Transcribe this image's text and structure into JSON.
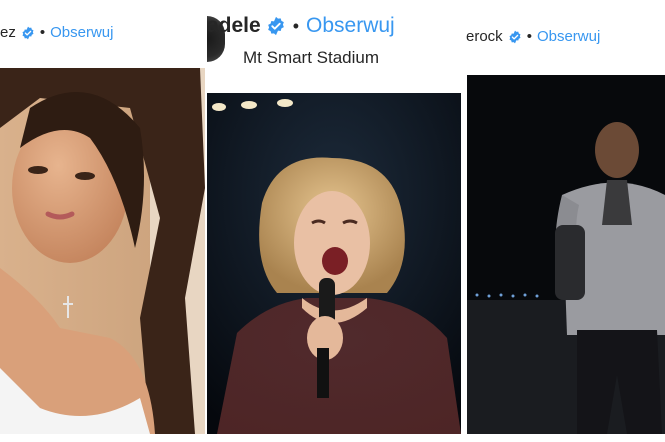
{
  "posts": [
    {
      "username": "ez",
      "follow_label": "Obserwuj",
      "separator": "•",
      "photo_icon": "selfie-portrait-photo"
    },
    {
      "username": "adele",
      "follow_label": "Obserwuj",
      "separator": "•",
      "location": "Mt Smart Stadium",
      "photo_icon": "concert-singer-photo"
    },
    {
      "username": "erock",
      "follow_label": "Obserwuj",
      "separator": "•",
      "photo_icon": "night-portrait-photo"
    }
  ],
  "colors": {
    "follow": "#3897f0",
    "verified": "#3897f0",
    "text": "#262626"
  }
}
